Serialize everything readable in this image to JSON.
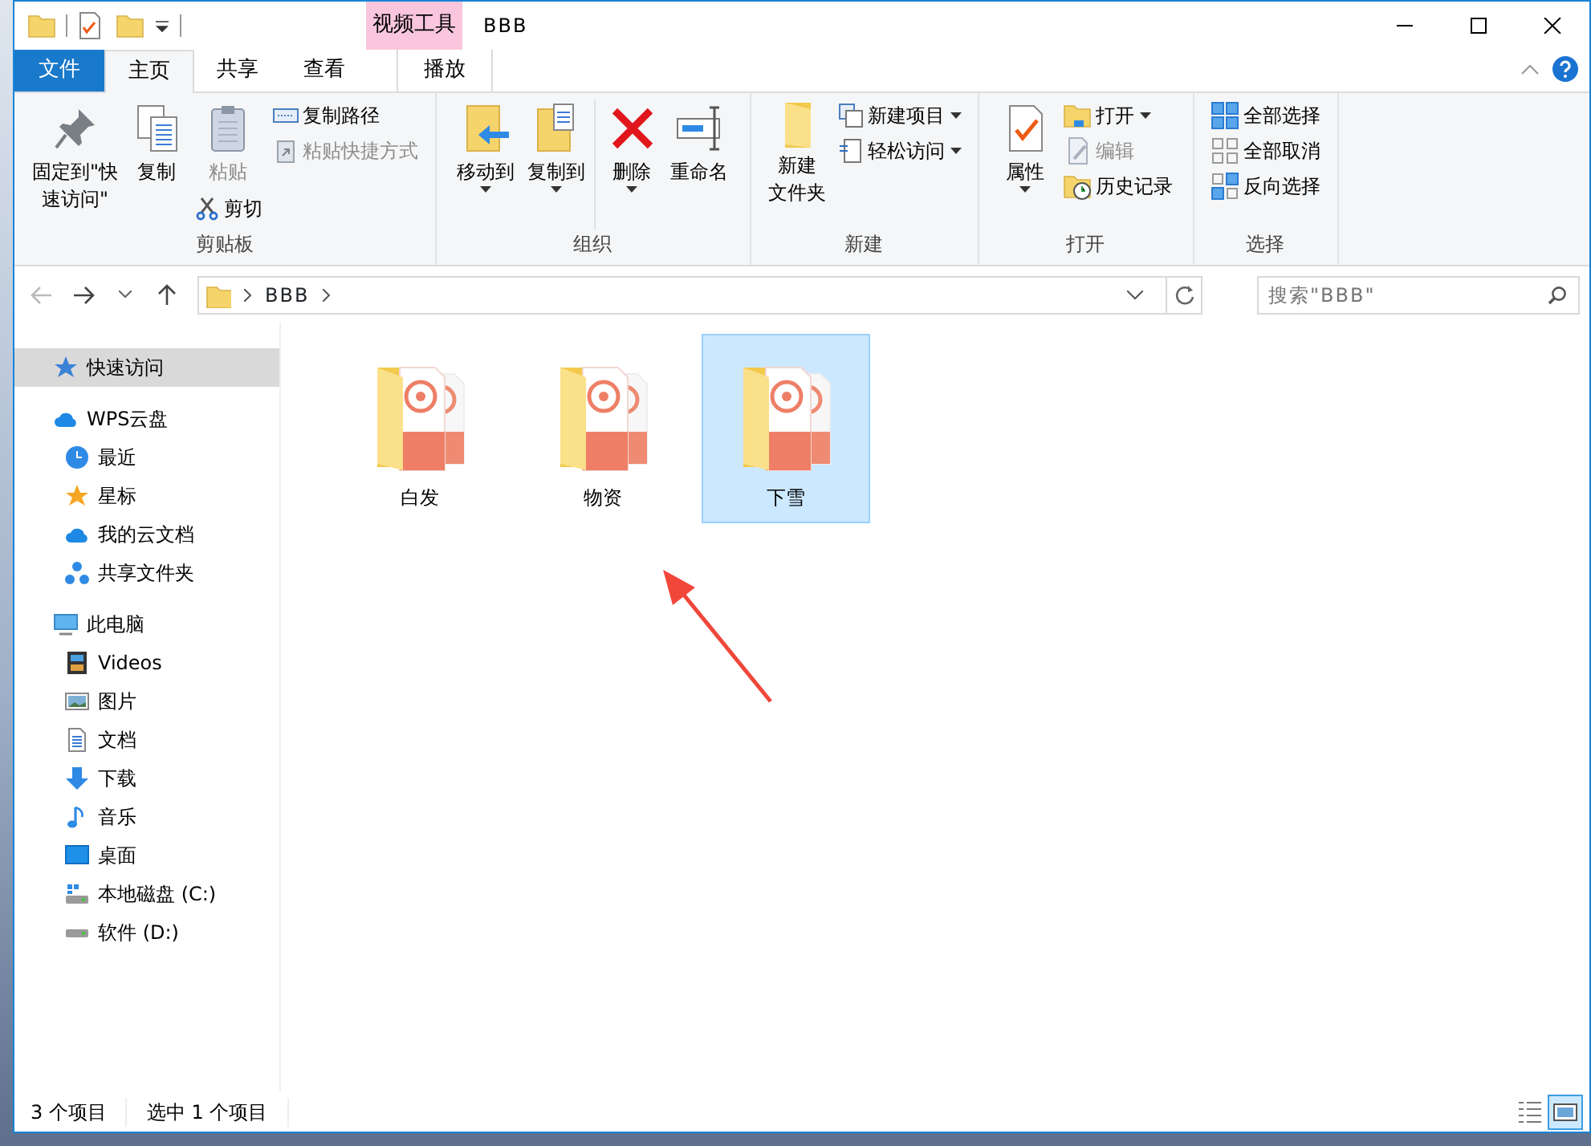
{
  "window": {
    "title": "BBB",
    "context_tab_group": "视频工具"
  },
  "ribbon_tabs": [
    {
      "label": "文件",
      "kind": "file",
      "selected": false
    },
    {
      "label": "主页",
      "kind": "normal",
      "selected": true
    },
    {
      "label": "共享",
      "kind": "normal",
      "selected": false
    },
    {
      "label": "查看",
      "kind": "normal",
      "selected": false
    },
    {
      "label": "播放",
      "kind": "context",
      "selected": false
    }
  ],
  "ribbon_groups": [
    {
      "label": "剪贴板",
      "columns": [
        [
          {
            "lines": [
              "固定到\"快",
              "速访问\""
            ],
            "kind": "large",
            "disabled": false,
            "has_menu": false
          }
        ],
        [
          {
            "lines": [
              "复制"
            ],
            "kind": "large",
            "disabled": false,
            "has_menu": false
          }
        ],
        [
          {
            "lines": [
              "粘贴"
            ],
            "kind": "large",
            "disabled": true,
            "has_menu": false
          },
          {
            "lines": [
              "剪切"
            ],
            "kind": "small",
            "disabled": false,
            "has_menu": false
          }
        ],
        [
          {
            "lines": [
              "复制路径"
            ],
            "kind": "small",
            "disabled": false,
            "has_menu": false
          },
          {
            "lines": [
              "粘贴快捷方式"
            ],
            "kind": "small",
            "disabled": true,
            "has_menu": false
          }
        ]
      ]
    },
    {
      "label": "组织",
      "columns": [
        [
          {
            "lines": [
              "移动到"
            ],
            "kind": "large",
            "disabled": false,
            "has_menu": true
          }
        ],
        [
          {
            "lines": [
              "复制到"
            ],
            "kind": "large",
            "disabled": false,
            "has_menu": true
          }
        ],
        [
          {
            "lines": [
              "删除"
            ],
            "kind": "large",
            "disabled": false,
            "has_menu": true
          }
        ],
        [
          {
            "lines": [
              "重命名"
            ],
            "kind": "large",
            "disabled": false,
            "has_menu": false
          }
        ]
      ]
    },
    {
      "label": "新建",
      "columns": [
        [
          {
            "lines": [
              "新建",
              "文件夹"
            ],
            "kind": "large",
            "disabled": false,
            "has_menu": false
          }
        ],
        [
          {
            "lines": [
              "新建项目"
            ],
            "kind": "small",
            "disabled": false,
            "has_menu": true
          },
          {
            "lines": [
              "轻松访问"
            ],
            "kind": "small",
            "disabled": false,
            "has_menu": true
          }
        ]
      ]
    },
    {
      "label": "打开",
      "columns": [
        [
          {
            "lines": [
              "属性"
            ],
            "kind": "large",
            "disabled": false,
            "has_menu": true
          }
        ],
        [
          {
            "lines": [
              "打开"
            ],
            "kind": "small",
            "disabled": false,
            "has_menu": true
          },
          {
            "lines": [
              "编辑"
            ],
            "kind": "small",
            "disabled": true,
            "has_menu": false
          },
          {
            "lines": [
              "历史记录"
            ],
            "kind": "small",
            "disabled": false,
            "has_menu": false
          }
        ]
      ]
    },
    {
      "label": "选择",
      "columns": [
        [
          {
            "lines": [
              "全部选择"
            ],
            "kind": "small",
            "disabled": false,
            "has_menu": false
          },
          {
            "lines": [
              "全部取消"
            ],
            "kind": "small",
            "disabled": false,
            "has_menu": false
          },
          {
            "lines": [
              "反向选择"
            ],
            "kind": "small",
            "disabled": false,
            "has_menu": false
          }
        ]
      ]
    }
  ],
  "navigation": {
    "back_disabled": true,
    "forward_disabled": false,
    "path": [
      "BBB"
    ],
    "search_placeholder": "搜索\"BBB\""
  },
  "sidebar": [
    {
      "label": "快速访问",
      "kind": "quick",
      "selected": true
    },
    {
      "label": "WPS云盘",
      "kind": "cloud",
      "selected": false,
      "children": [
        {
          "label": "最近",
          "kind": "recent",
          "selected": false
        },
        {
          "label": "星标",
          "kind": "star",
          "selected": false
        },
        {
          "label": "我的云文档",
          "kind": "cloud",
          "selected": false
        },
        {
          "label": "共享文件夹",
          "kind": "share",
          "selected": false
        }
      ]
    },
    {
      "label": "此电脑",
      "kind": "pc",
      "selected": false,
      "children": [
        {
          "label": "Videos",
          "kind": "videos",
          "selected": false
        },
        {
          "label": "图片",
          "kind": "pictures",
          "selected": false
        },
        {
          "label": "文档",
          "kind": "documents",
          "selected": false
        },
        {
          "label": "下载",
          "kind": "downloads",
          "selected": false
        },
        {
          "label": "音乐",
          "kind": "music",
          "selected": false
        },
        {
          "label": "桌面",
          "kind": "desktop",
          "selected": false
        },
        {
          "label": "本地磁盘 (C:)",
          "kind": "sysdrive",
          "selected": false
        },
        {
          "label": "软件 (D:)",
          "kind": "drive",
          "selected": false
        }
      ]
    }
  ],
  "files": [
    {
      "name": "白发",
      "selected": false
    },
    {
      "name": "物资",
      "selected": false
    },
    {
      "name": "下雪",
      "selected": true
    }
  ],
  "status_bar": {
    "item_count": "3 个项目",
    "selection": "选中 1 个项目"
  },
  "view_modes": [
    {
      "kind": "details",
      "selected": false
    },
    {
      "kind": "large_icons",
      "selected": true
    }
  ]
}
